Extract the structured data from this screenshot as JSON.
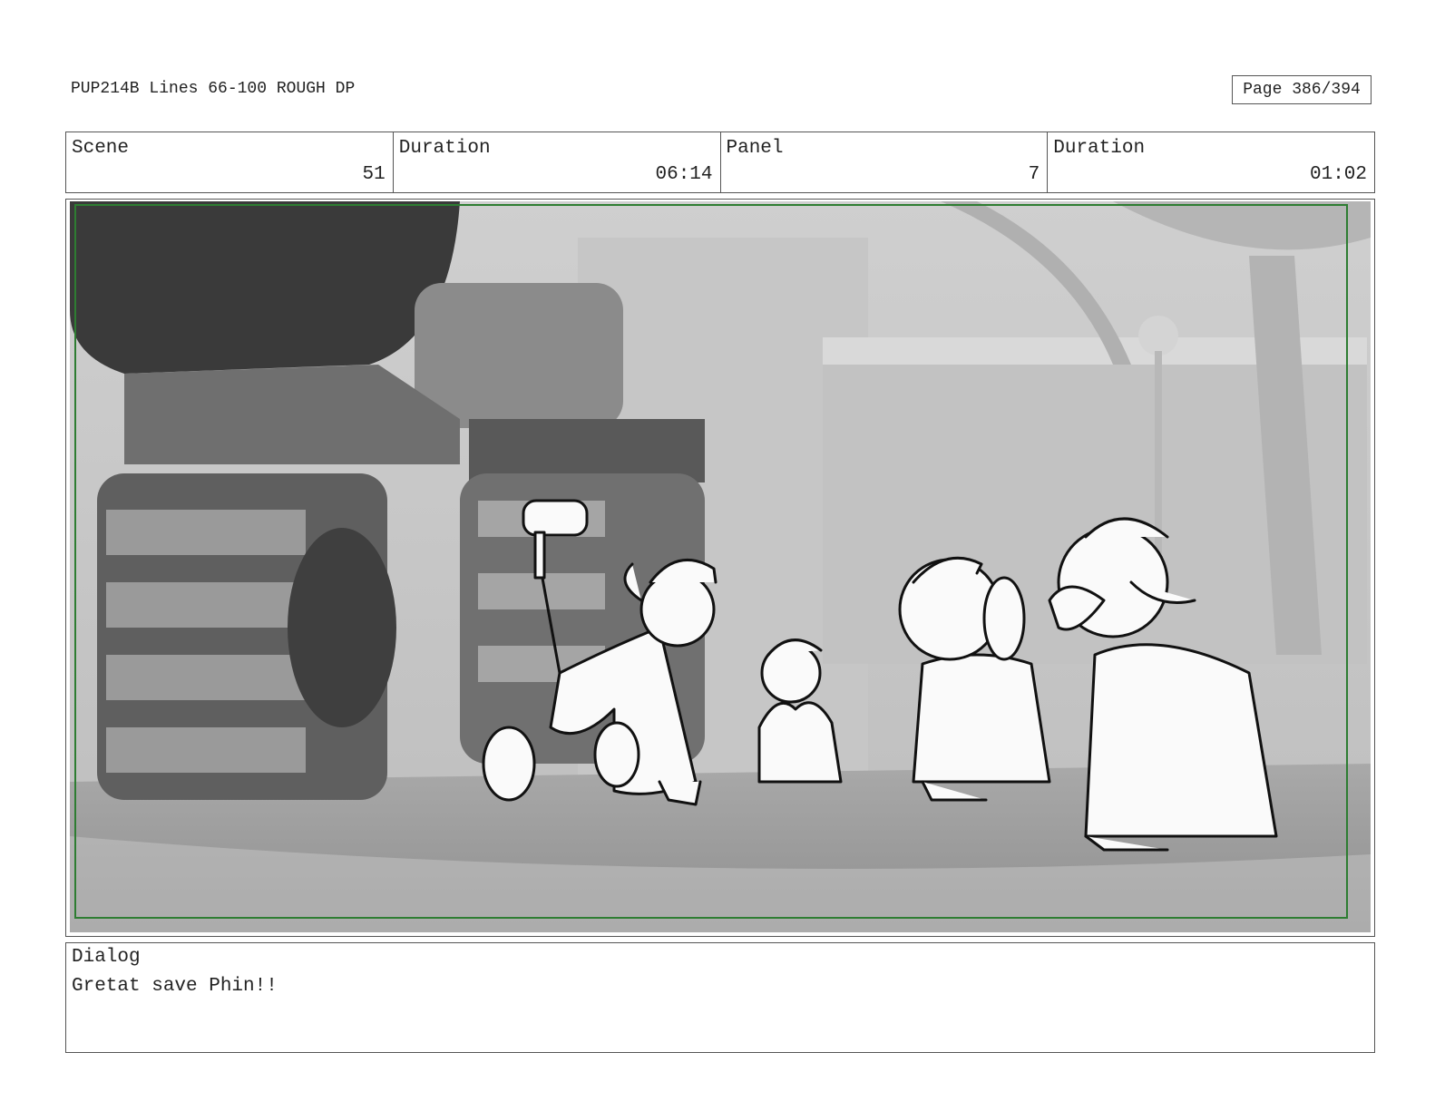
{
  "header": {
    "title": "PUP214B Lines 66-100 ROUGH DP",
    "page": "Page 386/394"
  },
  "info": {
    "scene_label": "Scene",
    "scene_value": "51",
    "duration_label": "Duration",
    "duration_value": "06:14",
    "panel_label": "Panel",
    "panel_value": "7",
    "panel_duration_label": "Duration",
    "panel_duration_value": "01:02"
  },
  "dialog": {
    "label": "Dialog",
    "text": "Gretat save Phin!!"
  }
}
